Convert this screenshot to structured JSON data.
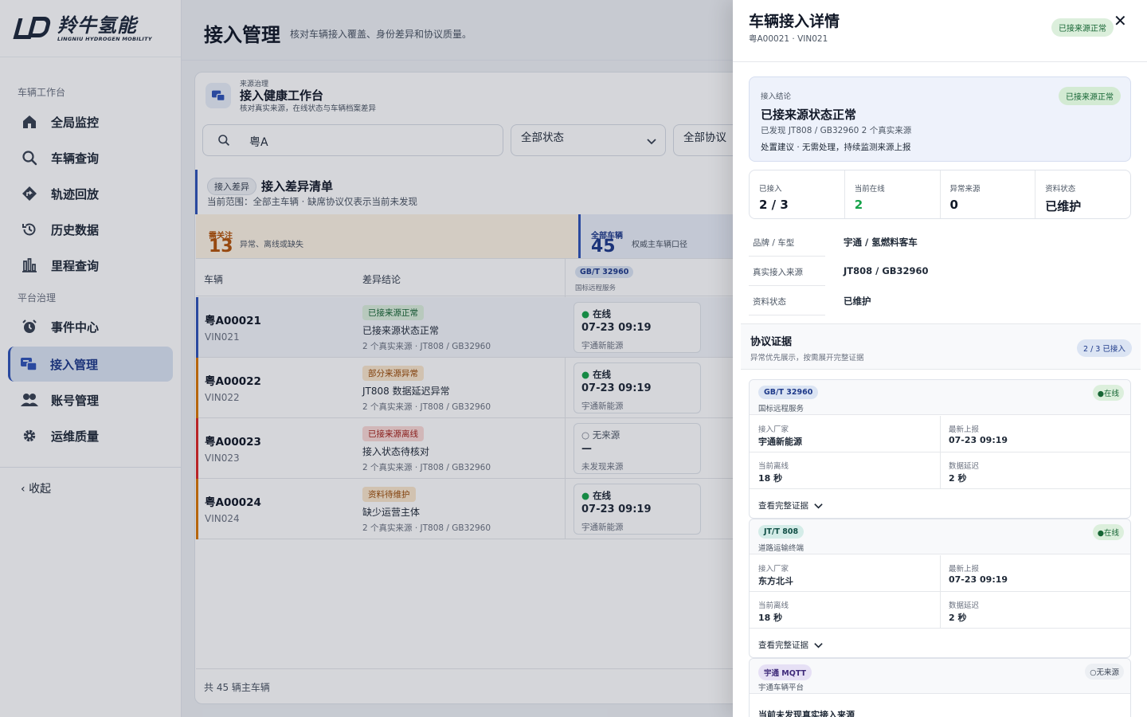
{
  "brand": {
    "name_cn": "羚牛氢能",
    "name_en": "LINGNIU HYDROGEN MOBILITY"
  },
  "sidebar": {
    "group1": "车辆工作台",
    "group2": "平台治理",
    "items": [
      {
        "label": "全局监控",
        "icon": "home-icon"
      },
      {
        "label": "车辆查询",
        "icon": "search-icon"
      },
      {
        "label": "轨迹回放",
        "icon": "route-icon"
      },
      {
        "label": "历史数据",
        "icon": "history-icon"
      },
      {
        "label": "里程查询",
        "icon": "bar-chart-icon"
      },
      {
        "label": "事件中心",
        "icon": "alarm-icon"
      },
      {
        "label": "接入管理",
        "icon": "access-icon"
      },
      {
        "label": "账号管理",
        "icon": "users-icon"
      },
      {
        "label": "运维质量",
        "icon": "gear-icon"
      }
    ],
    "active": "接入管理",
    "collapse": "收起"
  },
  "page": {
    "title": "接入管理",
    "subtitle": "核对车辆接入覆盖、身份差异和协议质量。"
  },
  "workspace": {
    "kicker": "来源治理",
    "title": "接入健康工作台",
    "desc": "核对真实来源，在线状态与车辆档案差异"
  },
  "filters": {
    "search_value": "粤A",
    "status": "全部状态",
    "protocol": "全部协议"
  },
  "diff": {
    "chip": "接入差异",
    "title": "接入差异清单",
    "scope": "当前范围：全部主车辆 · 缺席协议仅表示当前未发现"
  },
  "stats": {
    "attention": {
      "label": "需关注",
      "value": "13",
      "desc": "异常、离线或缺失"
    },
    "all": {
      "label": "全部车辆",
      "value": "45",
      "desc": "权威主车辆口径"
    }
  },
  "table": {
    "col_vehicle": "车辆",
    "col_conclusion": "差异结论",
    "col_protocol": "GB/T 32960",
    "col_protocol_desc": "国标远程服务",
    "rows": [
      {
        "plate": "粤A00021",
        "vin": "VIN021",
        "badge": "已接来源正常",
        "conclusion": "已接来源状态正常",
        "sources": "2 个真实来源 · JT808 / GB32960",
        "status": "在线",
        "time": "07-23 09:19",
        "vendor": "宇通新能源"
      },
      {
        "plate": "粤A00022",
        "vin": "VIN022",
        "badge": "部分来源异常",
        "conclusion": "JT808 数据延迟异常",
        "sources": "2 个真实来源 · JT808 / GB32960",
        "status": "在线",
        "time": "07-23 09:19",
        "vendor": "宇通新能源"
      },
      {
        "plate": "粤A00023",
        "vin": "VIN023",
        "badge": "已接来源离线",
        "conclusion": "接入状态待核对",
        "sources": "2 个真实来源 · JT808 / GB32960",
        "status": "无来源",
        "time": "—",
        "vendor": "未发现来源"
      },
      {
        "plate": "粤A00024",
        "vin": "VIN024",
        "badge": "资料待维护",
        "conclusion": "缺少运营主体",
        "sources": "2 个真实来源 · JT808 / GB32960",
        "status": "在线",
        "time": "07-23 09:19",
        "vendor": "宇通新能源"
      }
    ],
    "footer": "共 45 辆主车辆"
  },
  "drawer": {
    "title": "车辆接入详情",
    "sub": "粤A00021 · VIN021",
    "status_pill": "已接来源正常",
    "close": "✕",
    "conclusion": {
      "kicker": "接入结论",
      "pill": "已接来源正常",
      "title": "已接来源状态正常",
      "sub": "已发现 JT808 / GB32960 2 个真实来源",
      "advice": "处置建议 · 无需处理，持续监测来源上报"
    },
    "metrics": [
      {
        "label": "已接入",
        "value": "2 / 3"
      },
      {
        "label": "当前在线",
        "value": "2"
      },
      {
        "label": "异常来源",
        "value": "0"
      },
      {
        "label": "资料状态",
        "value": "已维护"
      }
    ],
    "info": [
      {
        "label": "品牌 / 车型",
        "value": "宇通 / 氢燃料客车"
      },
      {
        "label": "真实接入来源",
        "value": "JT808 / GB32960"
      },
      {
        "label": "资料状态",
        "value": "已维护"
      }
    ],
    "proto_section": {
      "title": "协议证据",
      "sub": "异常优先展示，按需展开完整证据",
      "pill": "2 / 3 已接入"
    },
    "evidence": [
      {
        "proto": "GB/T 32960",
        "desc": "国标远程服务",
        "status": "●在线",
        "vendor_label": "接入厂家",
        "vendor": "宇通新能源",
        "last_label": "最新上报",
        "last": "07-23 09:19",
        "offline_label": "当前离线",
        "offline": "18 秒",
        "delay_label": "数据延迟",
        "delay": "2 秒",
        "more": "查看完整证据"
      },
      {
        "proto": "JT/T 808",
        "desc": "道路运输终端",
        "status": "●在线",
        "vendor_label": "接入厂家",
        "vendor": "东方北斗",
        "last_label": "最新上报",
        "last": "07-23 09:19",
        "offline_label": "当前离线",
        "offline": "18 秒",
        "delay_label": "数据延迟",
        "delay": "2 秒",
        "more": "查看完整证据"
      },
      {
        "proto": "宇通 MQTT",
        "desc": "宇通车辆平台",
        "status": "○无来源",
        "none": "当前未发现真实接入来源"
      }
    ]
  },
  "colors": {
    "accent": "#2f54b8",
    "ok": "#16a34a",
    "warn": "#d97706",
    "danger": "#dc2626",
    "attention_num": "#b45309"
  }
}
